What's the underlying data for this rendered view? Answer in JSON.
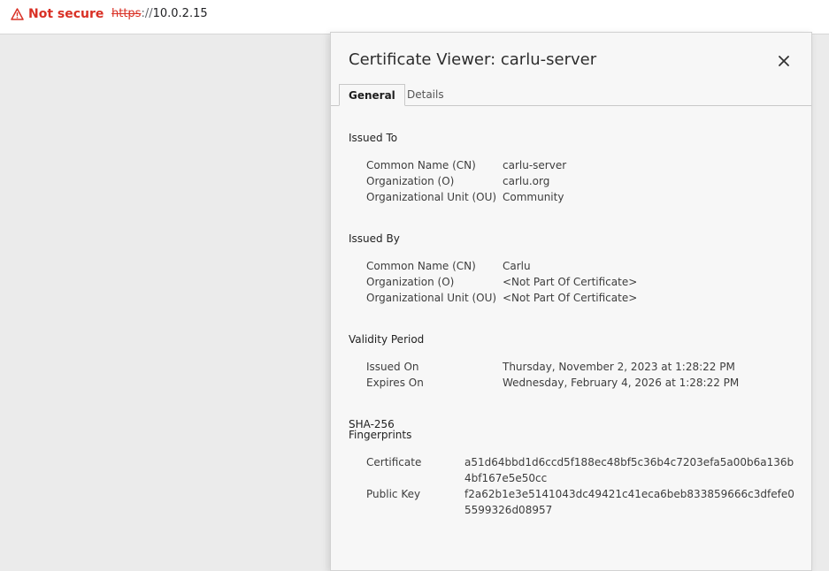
{
  "browser": {
    "security_label": "Not secure",
    "url_scheme": "https",
    "url_separator": "://",
    "url_host": "10.0.2.15",
    "warning_color": "#d93025"
  },
  "dialog": {
    "title": "Certificate Viewer: carlu-server",
    "tabs": [
      {
        "label": "General",
        "active": true
      },
      {
        "label": "Details",
        "active": false
      }
    ],
    "issued_to": {
      "heading": "Issued To",
      "rows": [
        {
          "label": "Common Name (CN)",
          "value": "carlu-server"
        },
        {
          "label": "Organization (O)",
          "value": "carlu.org"
        },
        {
          "label": "Organizational Unit (OU)",
          "value": "Community"
        }
      ]
    },
    "issued_by": {
      "heading": "Issued By",
      "rows": [
        {
          "label": "Common Name (CN)",
          "value": "Carlu"
        },
        {
          "label": "Organization (O)",
          "value": "<Not Part Of Certificate>"
        },
        {
          "label": "Organizational Unit (OU)",
          "value": "<Not Part Of Certificate>"
        }
      ]
    },
    "validity": {
      "heading": "Validity Period",
      "rows": [
        {
          "label": "Issued On",
          "value": "Thursday, November 2, 2023 at 1:28:22 PM"
        },
        {
          "label": "Expires On",
          "value": "Wednesday, February 4, 2026 at 1:28:22 PM"
        }
      ]
    },
    "fingerprints": {
      "heading_line1": "SHA-256",
      "heading_line2": "Fingerprints",
      "rows": [
        {
          "label": "Certificate",
          "value": "a51d64bbd1d6ccd5f188ec48bf5c36b4c7203efa5a00b6a136b4bf167e5e50cc"
        },
        {
          "label": "Public Key",
          "value": "f2a62b1e3e5141043dc49421c41eca6beb833859666c3dfefe05599326d08957"
        }
      ]
    }
  }
}
